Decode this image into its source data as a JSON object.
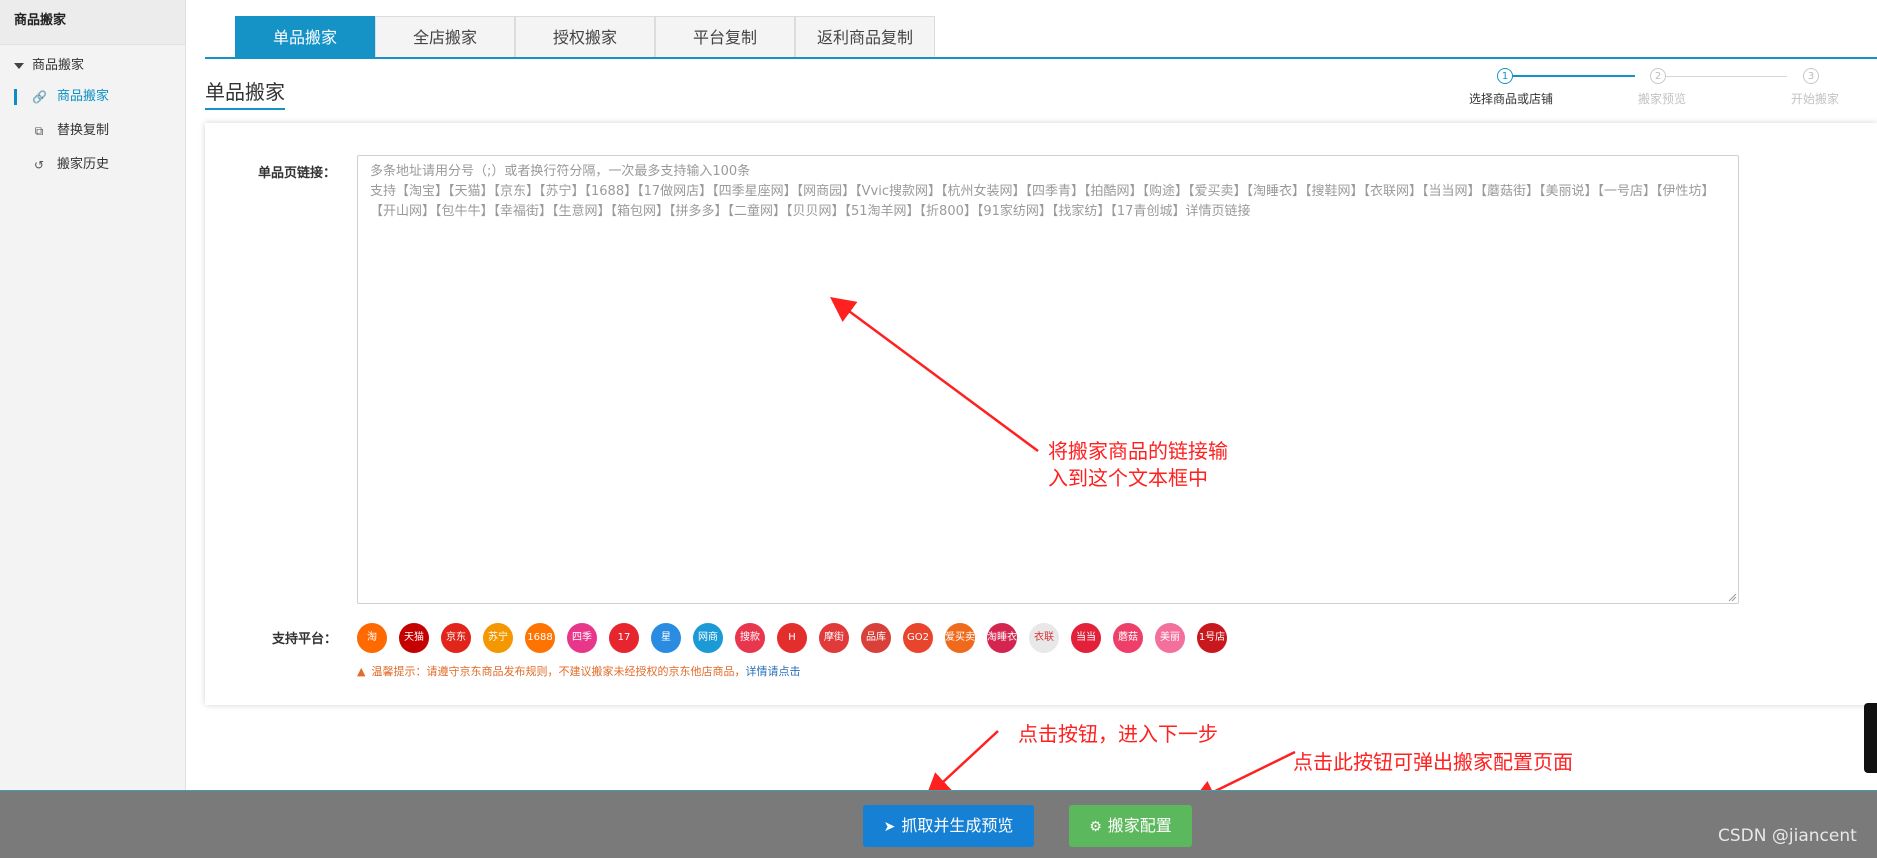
{
  "sidebar": {
    "title": "商品搬家",
    "group_label": "商品搬家",
    "items": [
      {
        "label": "商品搬家",
        "icon": "link-icon"
      },
      {
        "label": "替换复制",
        "icon": "copy-icon"
      },
      {
        "label": "搬家历史",
        "icon": "history-icon"
      }
    ]
  },
  "tabs": [
    {
      "label": "单品搬家"
    },
    {
      "label": "全店搬家"
    },
    {
      "label": "授权搬家"
    },
    {
      "label": "平台复制"
    },
    {
      "label": "返利商品复制"
    }
  ],
  "section_title": "单品搬家",
  "steps": [
    {
      "num": "1",
      "label": "选择商品或店铺"
    },
    {
      "num": "2",
      "label": "搬家预览"
    },
    {
      "num": "3",
      "label": "开始搬家"
    }
  ],
  "form": {
    "link_label": "单品页链接：",
    "placeholder": "多条地址请用分号（;）或者换行符分隔，一次最多支持输入100条\n支持【淘宝】【天猫】【京东】【苏宁】【1688】【17做网店】【四季星座网】【网商园】【Vvic搜款网】【杭州女装网】【四季青】【拍酷网】【购途】【爱买卖】【淘睡衣】【搜鞋网】【衣联网】【当当网】【蘑菇街】【美丽说】【一号店】【伊性坊】【开山网】【包牛牛】【幸福街】【生意网】【箱包网】【拼多多】【二童网】【贝贝网】【51淘羊网】【折800】【91家纺网】【找家纺】【17青创城】详情页链接",
    "platforms_label": "支持平台：",
    "platforms": [
      {
        "name": "淘",
        "color": "#ff6a00"
      },
      {
        "name": "天猫",
        "color": "#c40000"
      },
      {
        "name": "京东",
        "color": "#e1251b"
      },
      {
        "name": "苏宁",
        "color": "#f39800"
      },
      {
        "name": "1688",
        "color": "#ff7300"
      },
      {
        "name": "四季",
        "color": "#e8378a"
      },
      {
        "name": "17",
        "color": "#e6252f"
      },
      {
        "name": "星",
        "color": "#2a8ce0"
      },
      {
        "name": "网商",
        "color": "#1c9ad6"
      },
      {
        "name": "搜款",
        "color": "#e8364e"
      },
      {
        "name": "H",
        "color": "#e42d2d"
      },
      {
        "name": "摩街",
        "color": "#e03a3a"
      },
      {
        "name": "品库",
        "color": "#d9403a"
      },
      {
        "name": "GO2",
        "color": "#e8452c"
      },
      {
        "name": "爱买卖",
        "color": "#ef6a1c"
      },
      {
        "name": "淘睡衣",
        "color": "#d32550"
      },
      {
        "name": "衣联",
        "color": "#e8e8e8"
      },
      {
        "name": "当当",
        "color": "#e3213b"
      },
      {
        "name": "蘑菇",
        "color": "#ee3f6a"
      },
      {
        "name": "美丽",
        "color": "#f4709c"
      },
      {
        "name": "1号店",
        "color": "#c8181e"
      }
    ],
    "tip_text": "温馨提示：请遵守京东商品发布规则，不建议搬家未经授权的京东他店商品，",
    "tip_link": "详情请点击"
  },
  "annotations": {
    "textarea_note": "将搬家商品的链接输\n入到这个文本框中",
    "next_note": "点击按钮，进入下一步",
    "config_note": "点击此按钮可弹出搬家配置页面"
  },
  "footer": {
    "primary_label": "抓取并生成预览",
    "config_label": "搬家配置"
  },
  "watermark": "CSDN @jiancent",
  "colors": {
    "accent": "#1593c7",
    "primary_button": "#1580d4",
    "success_button": "#5cb85c",
    "annotation": "#ff2020"
  }
}
